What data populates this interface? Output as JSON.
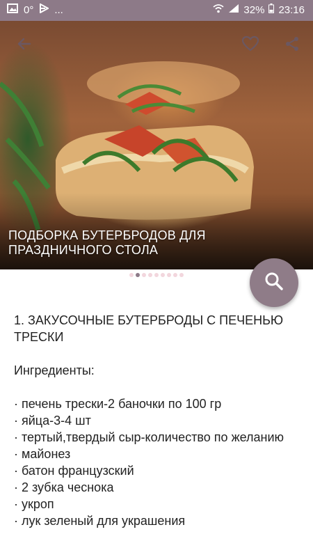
{
  "status_bar": {
    "signal_text": "0°",
    "ellipsis": "...",
    "battery": "32%",
    "time": "23:16"
  },
  "hero": {
    "title": "ПОДБОРКА БУТЕРБРОДОВ ДЛЯ ПРАЗДНИЧНОГО СТОЛА",
    "page_count": 9,
    "active_page": 2
  },
  "article": {
    "heading": "1. ЗАКУСОЧНЫЕ БУТЕРБРОДЫ С ПЕЧЕНЬЮ ТРЕСКИ",
    "ingredients_label": "Ингредиенты:",
    "ingredients": [
      "· печень трески-2 баночки по 100 гр",
      "· яйца-3-4 шт",
      "· тертый,твердый сыр-количество по желанию",
      "· майонез",
      "· батон французский",
      "· 2 зубка чеснока",
      "· укроп",
      "· лук зеленый для украшения"
    ]
  },
  "colors": {
    "accent": "#8d7a88",
    "pager_inactive": "#f2d6dd",
    "text": "#222222"
  },
  "icons": {
    "back": "arrow-left-icon",
    "favorite": "heart-outline-icon",
    "share": "share-icon",
    "search": "magnifier-icon"
  }
}
